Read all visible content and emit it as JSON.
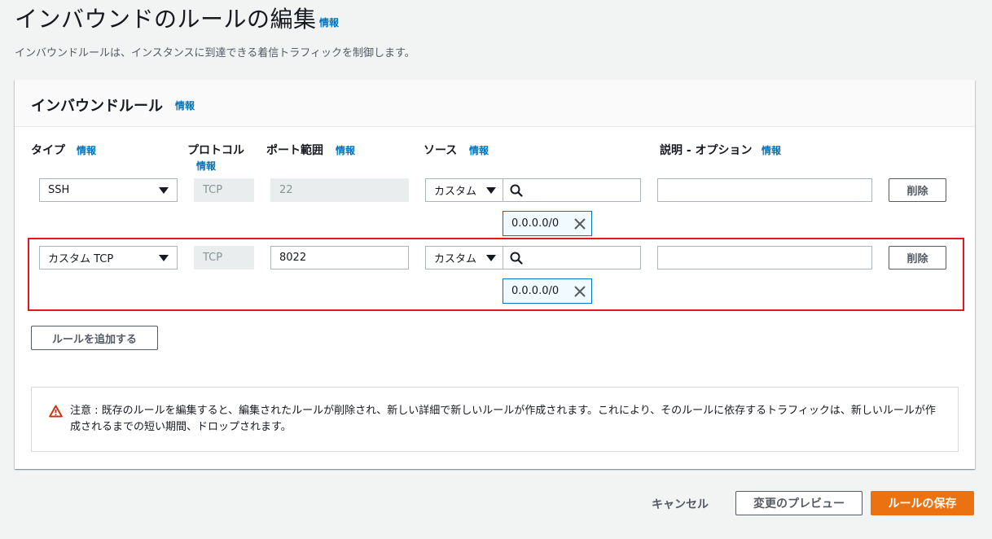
{
  "page": {
    "title": "インバウンドのルールの編集",
    "info": "情報",
    "description": "インバウンドルールは、インスタンスに到達できる着信トラフィックを制御します。"
  },
  "panel": {
    "title": "インバウンドルール",
    "info": "情報",
    "columns": {
      "type": "タイプ",
      "type_info": "情報",
      "protocol": "プロトコル",
      "protocol_info": "情報",
      "port_range": "ポート範囲",
      "port_info": "情報",
      "source": "ソース",
      "source_info": "情報",
      "description": "説明 - オプション",
      "description_info": "情報"
    },
    "rules": [
      {
        "type": "SSH",
        "protocol": "TCP",
        "port": "22",
        "source_mode": "カスタム",
        "cidr": "0.0.0.0/0",
        "description": "",
        "delete_label": "削除"
      },
      {
        "type": "カスタム TCP",
        "protocol": "TCP",
        "port": "8022",
        "source_mode": "カスタム",
        "cidr": "0.0.0.0/0",
        "description": "",
        "delete_label": "削除"
      }
    ],
    "add_rule_label": "ルールを追加する",
    "warning": "注意 : 既存のルールを編集すると、編集されたルールが削除され、新しい詳細で新しいルールが作成されます。これにより、そのルールに依存するトラフィックは、新しいルールが作成されるまでの短い期間、ドロップされます。"
  },
  "footer": {
    "cancel_label": "キャンセル",
    "preview_label": "変更のプレビュー",
    "save_label": "ルールの保存"
  },
  "colors": {
    "accent": "#ec7211",
    "link": "#0073bb",
    "highlight": "#e0191f",
    "warning": "#d13212"
  }
}
